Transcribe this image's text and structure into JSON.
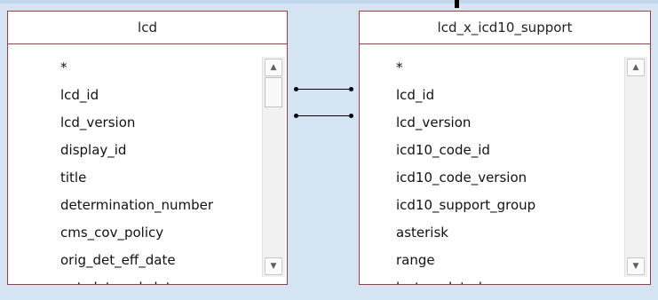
{
  "tables": [
    {
      "title": "lcd",
      "fields": [
        "*",
        "lcd_id",
        "lcd_version",
        "display_id",
        "title",
        "determination_number",
        "cms_cov_policy",
        "orig_det_eff_date",
        "ent_det_end_date"
      ]
    },
    {
      "title": "lcd_x_icd10_support",
      "fields": [
        "*",
        "lcd_id",
        "lcd_version",
        "icd10_code_id",
        "icd10_code_version",
        "icd10_support_group",
        "asterisk",
        "range",
        "last_updated"
      ]
    }
  ],
  "relationships": [
    {
      "from": "lcd.lcd_id",
      "to": "lcd_x_icd10_support.lcd_id"
    },
    {
      "from": "lcd.lcd_version",
      "to": "lcd_x_icd10_support.lcd_version"
    }
  ],
  "icons": {
    "scroll_up": "▲",
    "scroll_down": "▼"
  }
}
